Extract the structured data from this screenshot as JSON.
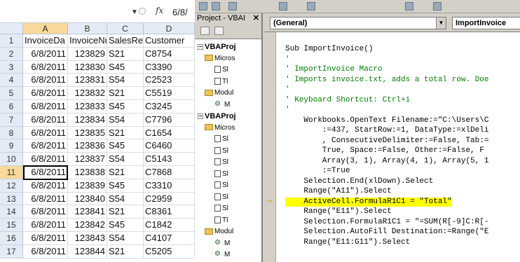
{
  "excel": {
    "formula_value": "6/8/",
    "columns": [
      "A",
      "B",
      "C",
      "D"
    ],
    "headers": [
      "InvoiceDa",
      "InvoiceNu",
      "SalesRep",
      "Customer"
    ],
    "rows": [
      {
        "n": "2",
        "a": "6/8/2011",
        "b": "123829",
        "c": "S21",
        "d": "C8754"
      },
      {
        "n": "3",
        "a": "6/8/2011",
        "b": "123830",
        "c": "S45",
        "d": "C3390"
      },
      {
        "n": "4",
        "a": "6/8/2011",
        "b": "123831",
        "c": "S54",
        "d": "C2523"
      },
      {
        "n": "5",
        "a": "6/8/2011",
        "b": "123832",
        "c": "S21",
        "d": "C5519"
      },
      {
        "n": "6",
        "a": "6/8/2011",
        "b": "123833",
        "c": "S45",
        "d": "C3245"
      },
      {
        "n": "7",
        "a": "6/8/2011",
        "b": "123834",
        "c": "S54",
        "d": "C7796"
      },
      {
        "n": "8",
        "a": "6/8/2011",
        "b": "123835",
        "c": "S21",
        "d": "C1654"
      },
      {
        "n": "9",
        "a": "6/8/2011",
        "b": "123836",
        "c": "S45",
        "d": "C6460"
      },
      {
        "n": "10",
        "a": "6/8/2011",
        "b": "123837",
        "c": "S54",
        "d": "C5143"
      },
      {
        "n": "11",
        "a": "6/8/2011",
        "b": "123838",
        "c": "S21",
        "d": "C7868"
      },
      {
        "n": "12",
        "a": "6/8/2011",
        "b": "123839",
        "c": "S45",
        "d": "C3310"
      },
      {
        "n": "13",
        "a": "6/8/2011",
        "b": "123840",
        "c": "S54",
        "d": "C2959"
      },
      {
        "n": "14",
        "a": "6/8/2011",
        "b": "123841",
        "c": "S21",
        "d": "C8361"
      },
      {
        "n": "15",
        "a": "6/8/2011",
        "b": "123842",
        "c": "S45",
        "d": "C1842"
      },
      {
        "n": "16",
        "a": "6/8/2011",
        "b": "123843",
        "c": "S54",
        "d": "C4107"
      },
      {
        "n": "17",
        "a": "6/8/2011",
        "b": "123844",
        "c": "S21",
        "d": "C5205"
      }
    ]
  },
  "project": {
    "title": "Project - VBAI",
    "tree": [
      {
        "label": "VBAProj",
        "kind": "proj"
      },
      {
        "label": "Micros",
        "kind": "folder"
      },
      {
        "label": "Sl",
        "kind": "sheet"
      },
      {
        "label": "Tl",
        "kind": "sheet"
      },
      {
        "label": "Modul",
        "kind": "folder"
      },
      {
        "label": "M",
        "kind": "module"
      },
      {
        "label": "VBAProj",
        "kind": "proj"
      },
      {
        "label": "Micros",
        "kind": "folder"
      },
      {
        "label": "Sl",
        "kind": "sheet"
      },
      {
        "label": "Sl",
        "kind": "sheet"
      },
      {
        "label": "Sl",
        "kind": "sheet"
      },
      {
        "label": "Sl",
        "kind": "sheet"
      },
      {
        "label": "Sl",
        "kind": "sheet"
      },
      {
        "label": "Sl",
        "kind": "sheet"
      },
      {
        "label": "Sl",
        "kind": "sheet"
      },
      {
        "label": "Tl",
        "kind": "sheet"
      },
      {
        "label": "Modul",
        "kind": "folder"
      },
      {
        "label": "M",
        "kind": "module"
      },
      {
        "label": "M",
        "kind": "module"
      }
    ]
  },
  "code": {
    "general_combo": "(General)",
    "proc_combo": "ImportInvoice",
    "lines": [
      {
        "text": "Sub ImportInvoice()",
        "kind": "code"
      },
      {
        "text": "'",
        "kind": "cm"
      },
      {
        "text": "' ImportInvoice Macro",
        "kind": "cm"
      },
      {
        "text": "' Imports invoice.txt, adds a total row. Doe",
        "kind": "cm"
      },
      {
        "text": "'",
        "kind": "cm"
      },
      {
        "text": "' Keyboard Shortcut: Ctrl+i",
        "kind": "cm"
      },
      {
        "text": "'",
        "kind": "cm"
      },
      {
        "text": "    Workbooks.OpenText Filename:=\"C:\\Users\\C",
        "kind": "code"
      },
      {
        "text": "        :=437, StartRow:=1, DataType:=xlDeli",
        "kind": "code"
      },
      {
        "text": "        , ConsecutiveDelimiter:=False, Tab:=",
        "kind": "code"
      },
      {
        "text": "        True, Space:=False, Other:=False, F",
        "kind": "code"
      },
      {
        "text": "        Array(3, 1), Array(4, 1), Array(5, 1",
        "kind": "code"
      },
      {
        "text": "        :=True",
        "kind": "code"
      },
      {
        "text": "    Selection.End(xlDown).Select",
        "kind": "code"
      },
      {
        "text": "    Range(\"A11\").Select",
        "kind": "code"
      },
      {
        "text": "    ActiveCell.FormulaR1C1 = \"Total\"",
        "kind": "hl"
      },
      {
        "text": "    Range(\"E11\").Select",
        "kind": "code"
      },
      {
        "text": "    Selection.FormulaR1C1 = \"=SUM(R[-9]C:R[-",
        "kind": "code"
      },
      {
        "text": "    Selection.AutoFill Destination:=Range(\"E",
        "kind": "code"
      },
      {
        "text": "    Range(\"E11:G11\").Select",
        "kind": "code"
      }
    ]
  }
}
